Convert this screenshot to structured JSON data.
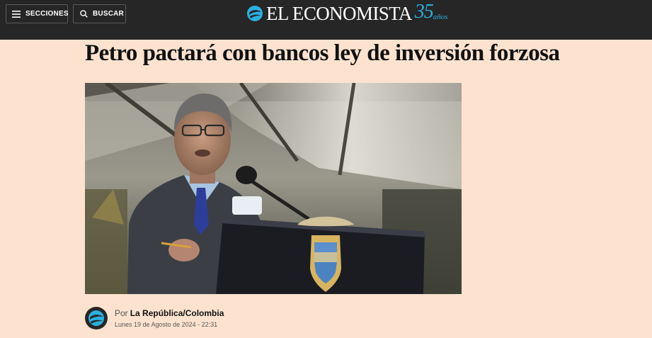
{
  "header": {
    "sections_label": "SECCIONES",
    "search_label": "BUSCAR",
    "logo_text": "EL ECONOMISTA",
    "anniversary_number": "35",
    "anniversary_word": "años"
  },
  "article": {
    "headline": "Petro pactará con bancos ley de inversión forzosa",
    "byline_prefix": "Por",
    "byline_author": "La República/Colombia",
    "date": "Lunes 19 de Agosto de 2024 - 22:31"
  },
  "colors": {
    "topbar": "#262626",
    "page_background": "#fde3cf",
    "brand_accent": "#2ab0e0",
    "text": "#111111"
  },
  "icons": {
    "menu": "hamburger-menu-icon",
    "search": "search-icon",
    "logo": "el-economista-logo-icon",
    "avatar": "el-economista-avatar-icon"
  }
}
